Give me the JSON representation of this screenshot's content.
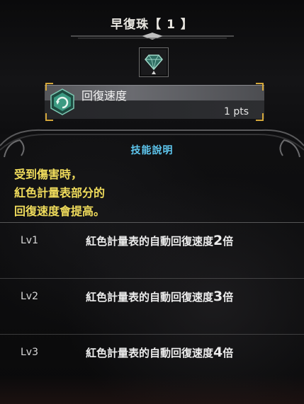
{
  "header": {
    "title": "早復珠【 1 】",
    "jewel_icon": "decoration-jewel-icon"
  },
  "skill": {
    "name": "回復速度",
    "points": "1 pts",
    "icon": "recovery-speed-skill-icon",
    "icon_color": "#3c9a82"
  },
  "section": {
    "title": "技能說明",
    "title_color": "#5ec6ee"
  },
  "description": {
    "lines": [
      "受到傷害時，",
      "紅色計量表部分的",
      "回復速度會提高。"
    ],
    "color": "#f0dc5c"
  },
  "levels": [
    {
      "label": "Lv1",
      "text": "紅色計量表的自動回復速度",
      "num": "2",
      "suffix": "倍"
    },
    {
      "label": "Lv2",
      "text": "紅色計量表的自動回復速度",
      "num": "3",
      "suffix": "倍"
    },
    {
      "label": "Lv3",
      "text": "紅色計量表的自動回復速度",
      "num": "4",
      "suffix": "倍"
    }
  ]
}
